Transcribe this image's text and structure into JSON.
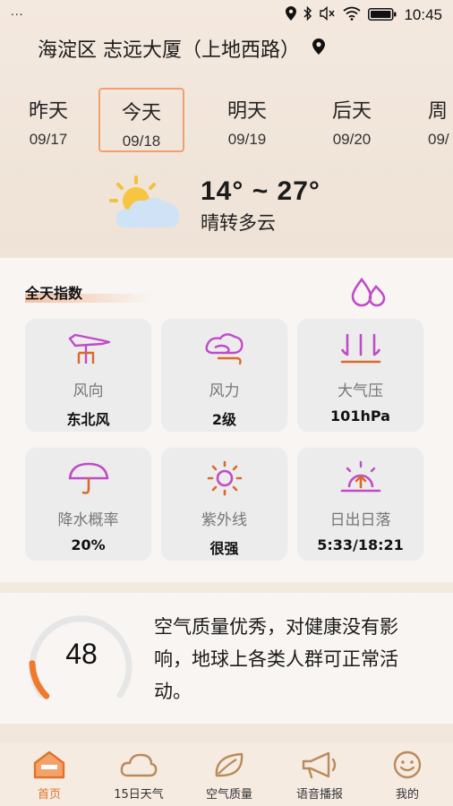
{
  "status_bar": {
    "left": "...",
    "time": "10:45"
  },
  "location": {
    "text": "海淀区 志远大厦（上地西路）"
  },
  "days": [
    {
      "name": "昨天",
      "date": "09/17",
      "selected": false
    },
    {
      "name": "今天",
      "date": "09/18",
      "selected": true
    },
    {
      "name": "明天",
      "date": "09/19",
      "selected": false
    },
    {
      "name": "后天",
      "date": "09/20",
      "selected": false
    },
    {
      "name": "周",
      "date": "09/",
      "selected": false
    }
  ],
  "today": {
    "temp_range": "14° ~  27°",
    "condition": "晴转多云",
    "icon": "partly-cloudy-icon"
  },
  "index": {
    "title": "全天指数",
    "tiles": [
      {
        "label": "风向",
        "value": "东北风",
        "icon": "wind-direction-icon"
      },
      {
        "label": "风力",
        "value": "2级",
        "icon": "wind-force-icon"
      },
      {
        "label": "大气压",
        "value": "101hPa",
        "icon": "pressure-icon"
      },
      {
        "label": "降水概率",
        "value": "20%",
        "icon": "umbrella-icon"
      },
      {
        "label": "紫外线",
        "value": "很强",
        "icon": "uv-sun-icon"
      },
      {
        "label": "日出日落",
        "value": "5:33/18:21",
        "icon": "sunrise-icon"
      }
    ]
  },
  "aqi": {
    "value": "48",
    "description": "空气质量优秀，对健康没有影响，地球上各类人群可正常活动。",
    "level": 0.16
  },
  "tabs": [
    {
      "label": "首页",
      "icon": "home-icon",
      "active": true
    },
    {
      "label": "15日天气",
      "icon": "cloud-icon",
      "active": false
    },
    {
      "label": "空气质量",
      "icon": "leaf-icon",
      "active": false
    },
    {
      "label": "语音播报",
      "icon": "megaphone-icon",
      "active": false
    },
    {
      "label": "我的",
      "icon": "smiley-icon",
      "active": false
    }
  ],
  "colors": {
    "accent": "#e0732c",
    "icon_purple": "#c04bc8",
    "tile_bg": "#ececec",
    "selected_border": "#f0a070"
  }
}
